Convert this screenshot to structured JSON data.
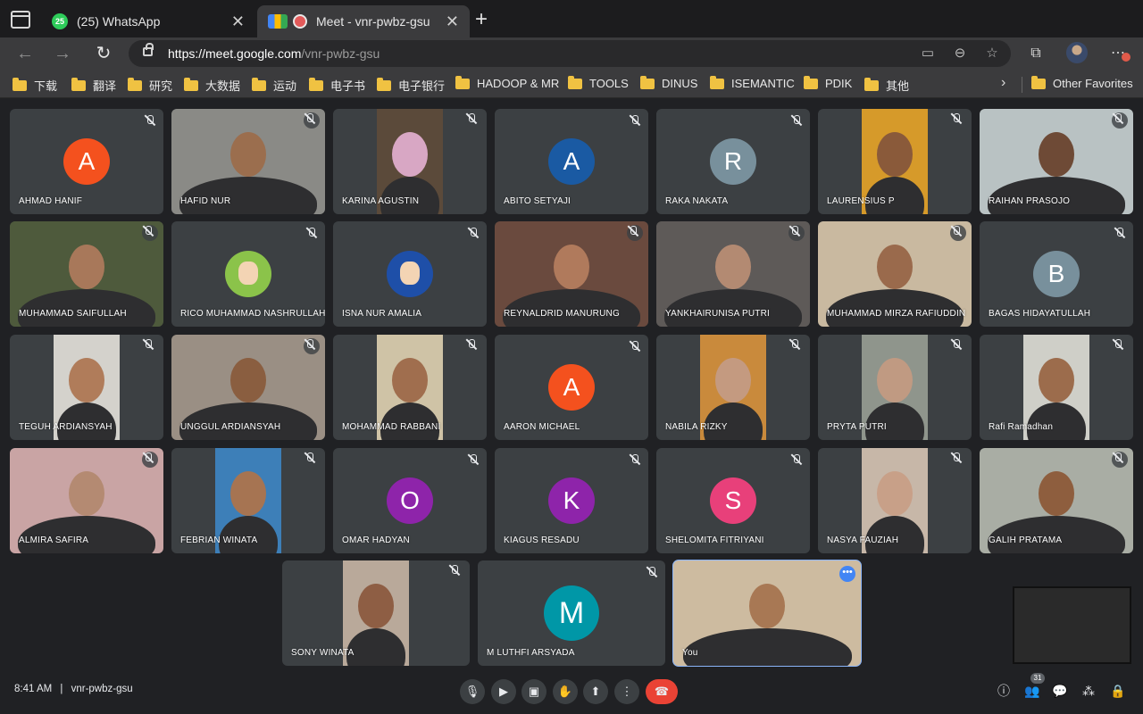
{
  "browser": {
    "tabs": [
      {
        "title": "(25) WhatsApp",
        "badge": "25"
      },
      {
        "title": "Meet - vnr-pwbz-gsu"
      }
    ],
    "url_host": "https://meet.google.com",
    "url_path": "/vnr-pwbz-gsu",
    "bookmarks": [
      "下载",
      "翻译",
      "研究",
      "大数据",
      "运动",
      "电子书",
      "电子银行",
      "HADOOP & MR",
      "TOOLS",
      "DINUS",
      "ISEMANTIC",
      "PDIK",
      "其他"
    ],
    "other_favorites": "Other Favorites"
  },
  "meeting": {
    "time": "8:41 AM",
    "separator": "|",
    "code": "vnr-pwbz-gsu",
    "participants_count": "31",
    "participants": [
      {
        "name": "AHMAD HANIF",
        "kind": "letter",
        "letter": "A",
        "color": "#f4511e"
      },
      {
        "name": "HAFID NUR",
        "kind": "video",
        "bg": "#8a8a86",
        "skin": "#9b6e4e"
      },
      {
        "name": "KARINA AGUSTIN",
        "kind": "video",
        "bg": "#5b4a3a",
        "skin": "#d8a7c4"
      },
      {
        "name": "ABITO SETYAJI",
        "kind": "letter",
        "letter": "A",
        "color": "#1a5aa3"
      },
      {
        "name": "RAKA NAKATA",
        "kind": "letter",
        "letter": "R",
        "color": "#78909c"
      },
      {
        "name": "LAURENSIUS P",
        "kind": "video",
        "bg": "#d69a2a",
        "skin": "#8a5a3a"
      },
      {
        "name": "RAIHAN PRASOJO",
        "kind": "video",
        "bg": "#b9c2c3",
        "skin": "#6e4a36"
      },
      {
        "name": "MUHAMMAD SAIFULLAH",
        "kind": "video",
        "bg": "#4e5a3c",
        "skin": "#a8785a"
      },
      {
        "name": "RICO MUHAMMAD NASHRULLAH",
        "kind": "image",
        "bg": "#8bc34a"
      },
      {
        "name": "ISNA NUR AMALIA",
        "kind": "image",
        "bg": "#1e4fa8"
      },
      {
        "name": "REYNALDRID MANURUNG",
        "kind": "video",
        "bg": "#6a4a3e",
        "skin": "#b07a5c"
      },
      {
        "name": "YANKHAIRUNISA PUTRI",
        "kind": "video",
        "bg": "#5e5a58",
        "skin": "#b38a72"
      },
      {
        "name": "MUHAMMAD MIRZA RAFIUDDIN",
        "kind": "video",
        "bg": "#c9b9a0",
        "skin": "#9a6a4c"
      },
      {
        "name": "BAGAS HIDAYATULLAH",
        "kind": "letter",
        "letter": "B",
        "color": "#78909c"
      },
      {
        "name": "TEGUH ARDIANSYAH",
        "kind": "video",
        "bg": "#d4d2cc",
        "skin": "#b07c5a"
      },
      {
        "name": "UNGGUL ARDIANSYAH",
        "kind": "video",
        "bg": "#9a8f84",
        "skin": "#8a5e40"
      },
      {
        "name": "MOHAMMAD RABBANI",
        "kind": "video",
        "bg": "#cfc3a6",
        "skin": "#a06e4e"
      },
      {
        "name": "AARON MICHAEL",
        "kind": "letter",
        "letter": "A",
        "color": "#f4511e"
      },
      {
        "name": "NABILA RIZKY",
        "kind": "video",
        "bg": "#c98a3c",
        "skin": "#c49a80"
      },
      {
        "name": "PRYTA PUTRI",
        "kind": "video",
        "bg": "#8f958c",
        "skin": "#c09a82"
      },
      {
        "name": "Rafi Ramadhan",
        "kind": "video",
        "bg": "#cfcfc8",
        "skin": "#9c6c4c"
      },
      {
        "name": "ALMIRA SAFIRA",
        "kind": "video",
        "bg": "#c9a4a4",
        "skin": "#b48a72"
      },
      {
        "name": "FEBRIAN WINATA",
        "kind": "video",
        "bg": "#3d7fb8",
        "skin": "#a67452"
      },
      {
        "name": "OMAR HADYAN",
        "kind": "letter",
        "letter": "O",
        "color": "#8e24aa"
      },
      {
        "name": "KIAGUS RESADU",
        "kind": "letter",
        "letter": "K",
        "color": "#8e24aa"
      },
      {
        "name": "SHELOMITA FITRIYANI",
        "kind": "letter",
        "letter": "S",
        "color": "#e8407a"
      },
      {
        "name": "NASYA FAUZIAH",
        "kind": "video",
        "bg": "#c7b7a8",
        "skin": "#c8a088"
      },
      {
        "name": "GALIH PRATAMA",
        "kind": "video",
        "bg": "#a9ada4",
        "skin": "#8e5e3e"
      },
      {
        "name": "SONY WINATA",
        "kind": "video",
        "bg": "#b9a99a",
        "skin": "#8e5e44"
      },
      {
        "name": "M LUTHFI ARSYADA",
        "kind": "letter",
        "letter": "M",
        "color": "#0097a7"
      },
      {
        "name": "You",
        "kind": "video",
        "bg": "#cdbba0",
        "skin": "#a87854"
      }
    ]
  },
  "icons": {
    "back": "back-arrow-icon",
    "forward": "forward-arrow-icon",
    "reload": "reload-icon",
    "mic": "microphone-icon",
    "camera": "camera-icon",
    "captions": "captions-icon",
    "hand": "raise-hand-icon",
    "present": "present-screen-icon",
    "more": "more-options-icon",
    "end": "end-call-icon",
    "info": "info-icon",
    "people": "people-icon",
    "chat": "chat-icon",
    "activities": "activities-icon",
    "lock": "host-controls-icon"
  }
}
